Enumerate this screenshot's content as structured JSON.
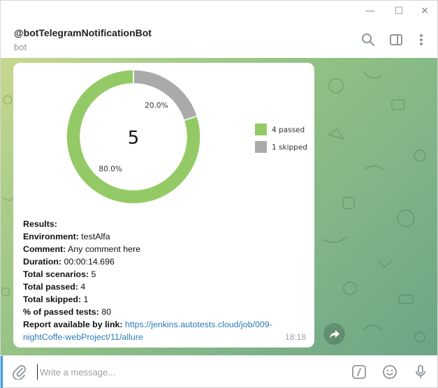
{
  "window": {
    "minimize_glyph": "—",
    "maximize_glyph": "☐",
    "close_glyph": "✕"
  },
  "header": {
    "title": "@botTelegramNotificationBot",
    "subtitle": "bot",
    "icons": [
      "search-icon",
      "sidebar-panel-icon",
      "more-vertical-icon"
    ]
  },
  "message": {
    "chart_data": {
      "type": "pie",
      "center_label": "5",
      "slices": [
        {
          "name": "passed",
          "value": 4,
          "percent": "80.0%",
          "color": "#94ca66"
        },
        {
          "name": "skipped",
          "value": 1,
          "percent": "20.0%",
          "color": "#aaaaaa"
        }
      ],
      "legend": [
        {
          "label": "4 passed",
          "color": "#94ca66"
        },
        {
          "label": "1 skipped",
          "color": "#aaaaaa"
        }
      ],
      "legend_position": "right"
    },
    "results_heading": "Results:",
    "lines": [
      {
        "label": "Environment:",
        "value": " testAlfa"
      },
      {
        "label": "Comment:",
        "value": " Any comment here"
      },
      {
        "label": "Duration:",
        "value": " 00:00:14.696"
      },
      {
        "label": "Total scenarios:",
        "value": " 5"
      },
      {
        "label": "Total passed:",
        "value": " 4"
      },
      {
        "label": "Total skipped:",
        "value": " 1"
      },
      {
        "label": "% of passed tests:",
        "value": " 80"
      }
    ],
    "report_label": "Report available by link:",
    "report_link_line1": "https://jenkins.autotests.cloud/job/009-",
    "report_link_line2": "nightCoffe-webProject/11/allure",
    "time": "18:18"
  },
  "composer": {
    "placeholder": "Write a message...",
    "icons": [
      "attach-icon",
      "bot-command-icon",
      "emoji-icon",
      "microphone-icon"
    ]
  },
  "colors": {
    "accent": "#3d9be9",
    "link": "#2a7ab8",
    "passed": "#94ca66",
    "skipped": "#aaaaaa"
  }
}
